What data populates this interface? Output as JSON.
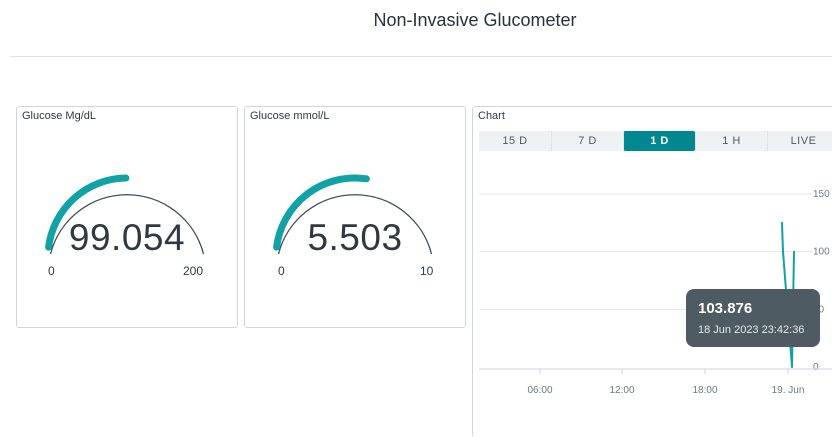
{
  "page": {
    "title": "Non-Invasive Glucometer"
  },
  "gauges": [
    {
      "title": "Glucose Mg/dL",
      "value": "99.054",
      "min": "0",
      "max": "200",
      "fraction": 0.495,
      "color": "#11a2a6"
    },
    {
      "title": "Glucose mmol/L",
      "value": "5.503",
      "min": "0",
      "max": "10",
      "fraction": 0.55,
      "color": "#11a2a6"
    }
  ],
  "chart": {
    "title": "Chart",
    "tabs": [
      "15 D",
      "7 D",
      "1 D",
      "1 H",
      "LIVE"
    ],
    "active_tab": "1 D",
    "tooltip": {
      "value": "103.876",
      "time": "18 Jun 2023 23:42:36"
    }
  },
  "chart_data": {
    "type": "line",
    "x": [
      "18 Jun 2023 23:00",
      "18 Jun 2023 23:38",
      "18 Jun 2023 23:40",
      "18 Jun 2023 23:42",
      "19 Jun 2023 00:08"
    ],
    "series": [
      {
        "values": [
          null,
          125,
          100,
          0,
          100
        ]
      }
    ],
    "xticks": [
      "06:00",
      "12:00",
      "18:00",
      "19. Jun"
    ],
    "yticks": [
      "0",
      "50",
      "100",
      "150"
    ],
    "ylim": [
      0,
      150
    ],
    "grid": true,
    "color": "#11a2a6"
  }
}
